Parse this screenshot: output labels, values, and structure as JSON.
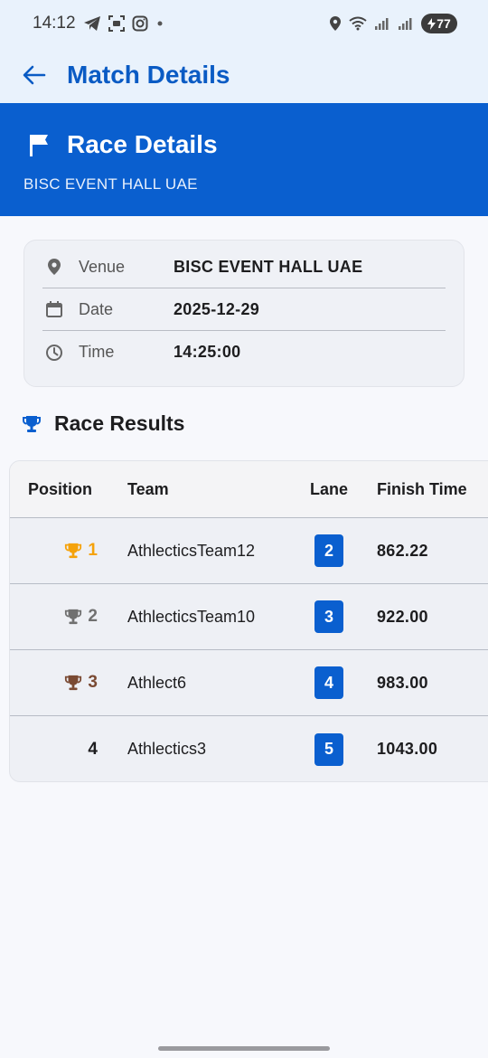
{
  "status_bar": {
    "time": "14:12",
    "battery": "77"
  },
  "app_bar": {
    "title": "Match Details"
  },
  "banner": {
    "title": "Race Details",
    "subtitle": "BISC EVENT HALL UAE"
  },
  "info": {
    "venue_label": "Venue",
    "venue_value": "BISC EVENT HALL UAE",
    "date_label": "Date",
    "date_value": "2025-12-29",
    "time_label": "Time",
    "time_value": "14:25:00"
  },
  "results": {
    "title": "Race Results",
    "columns": [
      "Position",
      "Team",
      "Lane",
      "Finish Time"
    ],
    "rows": [
      {
        "position": "1",
        "team": "AthlecticsTeam12",
        "lane": "2",
        "finish_time": "862.22",
        "trophy_color": "#f5a20a"
      },
      {
        "position": "2",
        "team": "AthlecticsTeam10",
        "lane": "3",
        "finish_time": "922.00",
        "trophy_color": "#707070"
      },
      {
        "position": "3",
        "team": "Athlect6",
        "lane": "4",
        "finish_time": "983.00",
        "trophy_color": "#7a4a33"
      },
      {
        "position": "4",
        "team": "Athlectics3",
        "lane": "5",
        "finish_time": "1043.00",
        "trophy_color": ""
      }
    ]
  },
  "colors": {
    "primary": "#0a5fcf",
    "gold": "#f5a20a",
    "silver": "#707070",
    "bronze": "#7a4a33"
  }
}
